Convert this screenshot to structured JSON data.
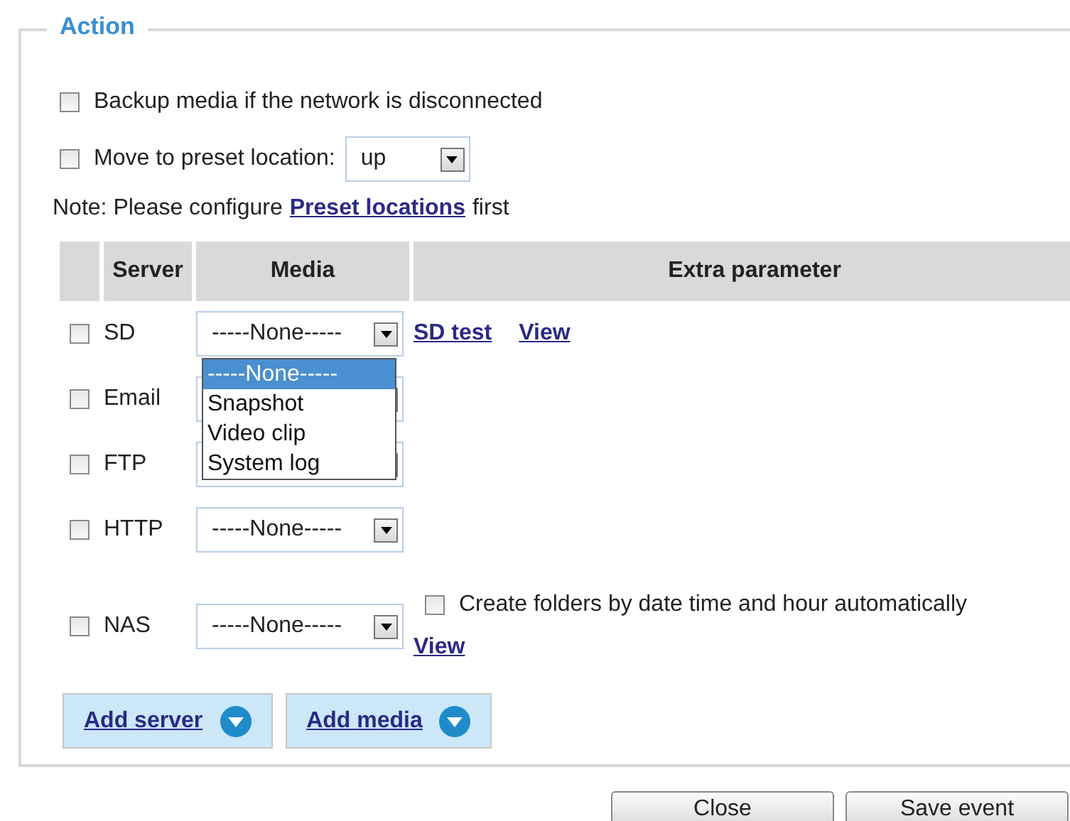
{
  "section": {
    "title": "Action"
  },
  "options": [
    {
      "label": "Backup media if the network is disconnected",
      "checked": false
    },
    {
      "label": "Move to preset location:",
      "checked": false,
      "select": {
        "value": "up"
      }
    }
  ],
  "note": {
    "link": "Preset locations",
    "before": "Note: Please configure",
    "after": "first"
  },
  "table": {
    "columns": [
      "Server",
      "Media",
      "Extra parameter"
    ],
    "rows": [
      {
        "server": "SD",
        "checked": false,
        "media": "-----None-----",
        "links": [
          "SD test",
          "View"
        ]
      },
      {
        "server": "Email",
        "checked": false
      },
      {
        "server": "FTP",
        "checked": false
      },
      {
        "server": "HTTP",
        "checked": false,
        "media": "-----None-----"
      },
      {
        "server": "NAS",
        "checked": false,
        "media": "-----None-----",
        "extra_checkbox": {
          "label": "Create folders by date time and hour automatically",
          "checked": false
        },
        "links": [
          "View"
        ]
      }
    ]
  },
  "dropdown": {
    "items": [
      {
        "label": "-----None-----",
        "selected": true
      },
      {
        "label": "Snapshot",
        "selected": false
      },
      {
        "label": "Video clip",
        "selected": false
      },
      {
        "label": "System log",
        "selected": false
      }
    ]
  },
  "add_buttons": [
    "Add server",
    "Add media"
  ],
  "footer_buttons": [
    "Close",
    "Save event"
  ]
}
